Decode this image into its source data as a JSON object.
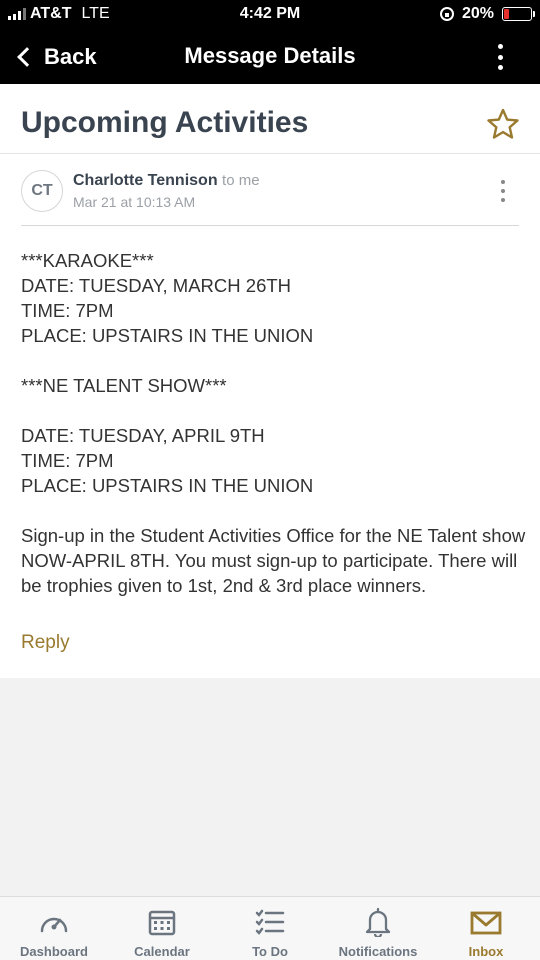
{
  "status_bar": {
    "carrier": "AT&T",
    "network": "LTE",
    "time": "4:42 PM",
    "battery_percent": "20%",
    "battery_level": 0.2,
    "battery_color": "#e5312d"
  },
  "nav": {
    "back_label": "Back",
    "title": "Message Details"
  },
  "message": {
    "subject": "Upcoming Activities",
    "starred": false,
    "sender_initials": "CT",
    "sender_name": "Charlotte Tennison",
    "recipient": "to me",
    "date": "Mar 21 at 10:13 AM",
    "body_paragraphs": [
      "***KARAOKE***\nDATE:  TUESDAY, MARCH 26TH\nTIME:  7PM\nPLACE:  UPSTAIRS IN THE UNION",
      "***NE TALENT SHOW***",
      "DATE:  TUESDAY, APRIL 9TH\nTIME:  7PM\nPLACE:  UPSTAIRS IN THE UNION",
      "Sign-up in the Student Activities Office for the NE Talent show NOW-APRIL 8TH.  You must sign-up to participate. There will be trophies given to 1st, 2nd & 3rd  place winners."
    ],
    "reply_label": "Reply"
  },
  "tab_bar": {
    "tabs": [
      {
        "label": "Dashboard",
        "icon": "gauge-icon",
        "active": false
      },
      {
        "label": "Calendar",
        "icon": "calendar-icon",
        "active": false
      },
      {
        "label": "To Do",
        "icon": "checklist-icon",
        "active": false
      },
      {
        "label": "Notifications",
        "icon": "bell-icon",
        "active": false
      },
      {
        "label": "Inbox",
        "icon": "envelope-icon",
        "active": true
      }
    ]
  },
  "colors": {
    "accent": "#9a7a2e",
    "nav_background": "#000000",
    "heading": "#3a4450",
    "muted": "#9aa0a6"
  }
}
